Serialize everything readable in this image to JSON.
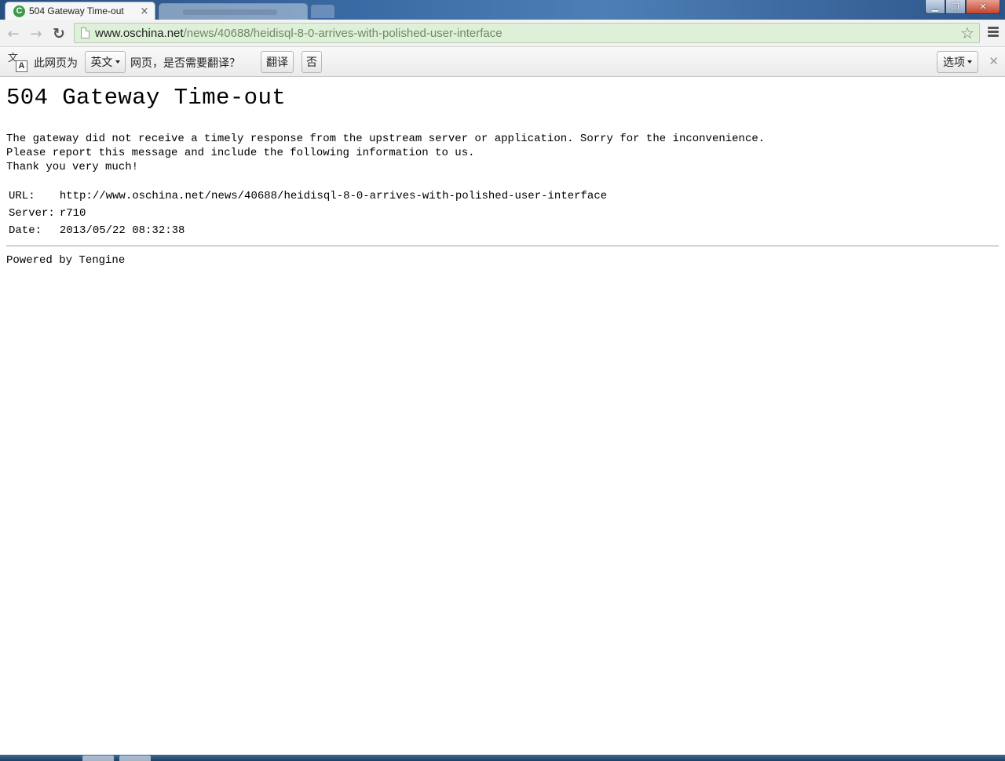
{
  "browser": {
    "active_tab": {
      "title": "504 Gateway Time-out",
      "favicon": "tengine-favicon",
      "close_glyph": "×"
    },
    "inactive_tab": {
      "title": ""
    },
    "window_controls": {
      "minimize_glyph": "▁",
      "maximize_glyph": "❐",
      "close_glyph": "✕"
    },
    "nav": {
      "back_glyph": "←",
      "forward_glyph": "→",
      "reload_glyph": "↻"
    },
    "address_bar": {
      "host": "www.oschina.net",
      "path": "/news/40688/heidisql-8-0-arrives-with-polished-user-interface",
      "bookmark_glyph": "☆"
    }
  },
  "translate_bar": {
    "icon_glyph_1": "文",
    "icon_glyph_2": "A",
    "prefix": "此网页为",
    "language": "英文",
    "suffix": "网页，是否需要翻译？",
    "translate_button": "翻译",
    "no_button": "否",
    "options_button": "选项",
    "close_glyph": "✕"
  },
  "page": {
    "heading": "504 Gateway Time-out",
    "message_lines": [
      "The gateway did not receive a timely response from the upstream server or application. Sorry for the inconvenience.",
      "Please report this message and include the following information to us.",
      "Thank you very much!"
    ],
    "info": {
      "url_label": "URL:",
      "url_value": "http://www.oschina.net/news/40688/heidisql-8-0-arrives-with-polished-user-interface",
      "server_label": "Server:",
      "server_value": "r710",
      "date_label": "Date:",
      "date_value": "2013/05/22 08:32:38"
    },
    "footer": "Powered by Tengine"
  },
  "colors": {
    "omnibox_bg": "#dff0d8",
    "url_path": "#6d8a67",
    "titlebar": "#3a6aa3",
    "favicon": "#3a9a4a"
  }
}
